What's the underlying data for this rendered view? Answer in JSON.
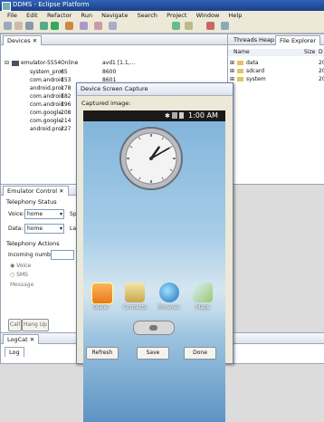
{
  "window": {
    "title": "DDMS - Eclipse Platform"
  },
  "menu": [
    "File",
    "Edit",
    "Refactor",
    "Run",
    "Navigate",
    "Search",
    "Project",
    "Window",
    "Help"
  ],
  "devices": {
    "tab": "Devices",
    "emulator": {
      "name": "emulator-5554",
      "state": "Online",
      "build": "avd1 [1.1,..."
    },
    "processes": [
      {
        "name": "system_proc",
        "pid": "65",
        "port": "8600"
      },
      {
        "name": "com.android",
        "pid": "153",
        "port": "8601"
      },
      {
        "name": "android.proc",
        "pid": "178",
        "port": ""
      },
      {
        "name": "com.android",
        "pid": "182",
        "port": ""
      },
      {
        "name": "com.android",
        "pid": "196",
        "port": ""
      },
      {
        "name": "com.google.",
        "pid": "208",
        "port": ""
      },
      {
        "name": "com.google.",
        "pid": "214",
        "port": ""
      },
      {
        "name": "android.proc",
        "pid": "227",
        "port": ""
      }
    ]
  },
  "right_panel": {
    "tabs": [
      "Threads",
      "Heap",
      "File Explorer"
    ],
    "columns": {
      "name": "Name",
      "size": "Size",
      "d": "D"
    },
    "files": [
      "data",
      "sdcard",
      "system"
    ],
    "file_dates": [
      "20",
      "20",
      "20"
    ]
  },
  "emulator_control": {
    "tab": "Emulator Control",
    "telephony_status": "Telephony Status",
    "voice_label": "Voice:",
    "voice_value": "home",
    "data_label": "Data:",
    "data_value": "home",
    "spe_label": "Spe",
    "lat_label": "Lat",
    "telephony_actions": "Telephony Actions",
    "incoming_number": "Incoming number:",
    "voice_radio": "Voice",
    "sms_radio": "SMS",
    "message_label": "Message",
    "call_btn": "Call",
    "hangup_btn": "Hang Up"
  },
  "logcat": {
    "tab": "LogCat",
    "log_tab": "Log"
  },
  "dialog": {
    "title": "Device Screen Capture",
    "captured_label": "Captured image:",
    "time": "1:00 AM",
    "apps": [
      "Dialer",
      "Contacts",
      "Browser",
      "Maps"
    ],
    "buttons": {
      "refresh": "Refresh",
      "save": "Save",
      "done": "Done"
    }
  },
  "clock": {
    "hour": 1,
    "minute": 10
  }
}
